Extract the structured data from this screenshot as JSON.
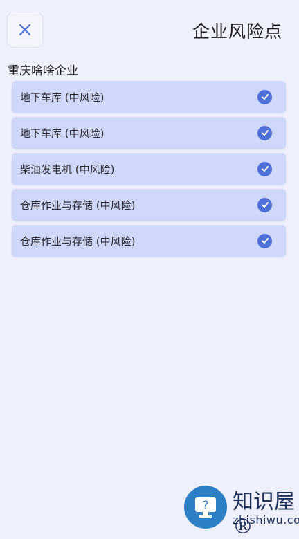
{
  "header": {
    "title": "企业风险点"
  },
  "section": {
    "company_name": "重庆啥啥企业"
  },
  "risk_items": [
    {
      "label": "地下车库 (中风险)",
      "checked": true
    },
    {
      "label": "地下车库 (中风险)",
      "checked": true
    },
    {
      "label": "柴油发电机 (中风险)",
      "checked": true
    },
    {
      "label": "仓库作业与存储 (中风险)",
      "checked": true
    },
    {
      "label": "仓库作业与存储 (中风险)",
      "checked": true
    }
  ],
  "watermark": {
    "brand": "知识屋®",
    "url": "zhishiwu.com"
  },
  "colors": {
    "background": "#eef0fb",
    "item_background": "#cfd7fa",
    "accent": "#4f6fd8"
  }
}
